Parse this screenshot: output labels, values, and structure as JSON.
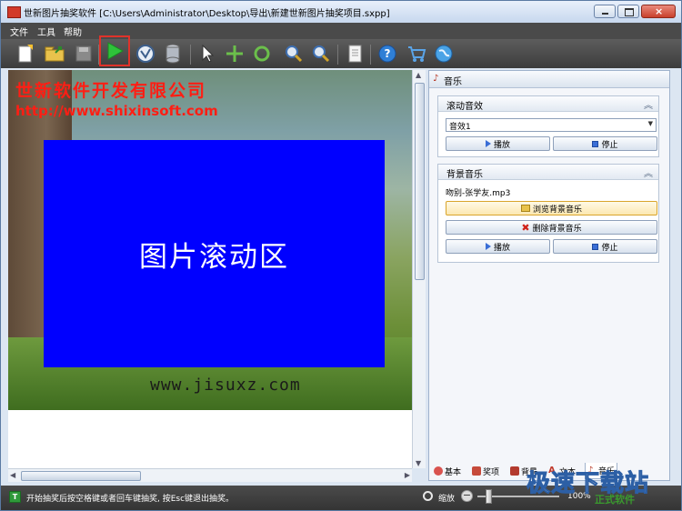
{
  "window": {
    "title": "世新图片抽奖软件 [C:\\Users\\Administrator\\Desktop\\导出\\新建世新图片抽奖项目.sxpp]"
  },
  "menu": {
    "items": [
      "文件",
      "工具",
      "帮助"
    ]
  },
  "toolbar": {
    "icons": [
      "new-file-icon",
      "open-folder-icon",
      "save-icon",
      "play-icon",
      "spin-lottery-icon",
      "database-icon",
      "pointer-icon",
      "move-icon",
      "rotate-icon",
      "zoom-in-icon",
      "zoom-out-icon",
      "document-icon",
      "help-icon",
      "cart-icon",
      "globe-icon"
    ],
    "highlight_color": "#e0322a"
  },
  "canvas": {
    "company_name": "世新软件开发有限公司",
    "company_url": "http://www.shixinsoft.com",
    "scroll_area_label": "图片滚动区",
    "site_text": "www.jisuxz.com",
    "scroll_area_color": "#0000ff",
    "company_color": "#ff1e14"
  },
  "panel": {
    "title": "音乐",
    "scroll_sound": {
      "title": "滚动音效",
      "selected_sound": "音效1",
      "play_label": "播放",
      "stop_label": "停止"
    },
    "background_music": {
      "title": "背景音乐",
      "file_name": "吻别-张学友.mp3",
      "browse_label": "浏览背景音乐",
      "delete_label": "删除背景音乐",
      "play_label": "播放",
      "stop_label": "停止"
    }
  },
  "tabs": [
    {
      "label": "基本",
      "icon": "gear-icon"
    },
    {
      "label": "奖项",
      "icon": "award-icon"
    },
    {
      "label": "背景",
      "icon": "picture-icon"
    },
    {
      "label": "文本",
      "icon": "text-icon"
    },
    {
      "label": "音乐",
      "icon": "music-note-icon"
    }
  ],
  "status": {
    "message": "开始抽奖后按空格键或者回车键抽奖, 按Esc键退出抽奖。",
    "zoom_label": "缩放",
    "zoom_percent": "100%"
  },
  "watermark": {
    "text": "极速下载站",
    "sub": "正式软件"
  }
}
